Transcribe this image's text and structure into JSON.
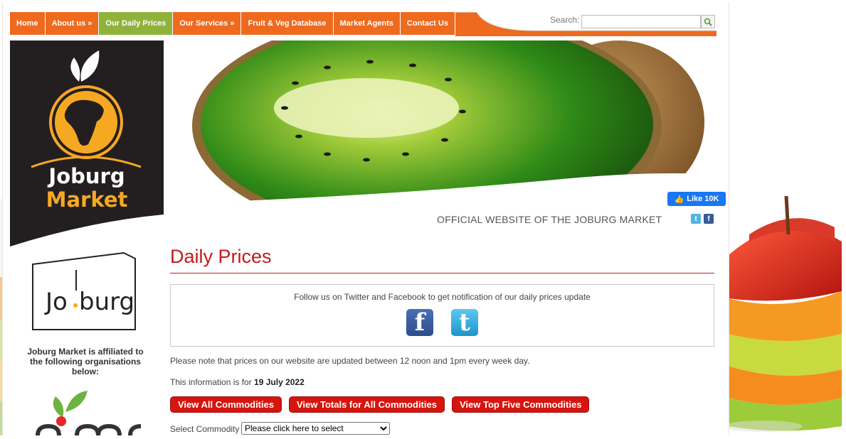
{
  "nav": {
    "items": [
      {
        "label": "Home"
      },
      {
        "label": "About us »"
      },
      {
        "label": "Our Daily Prices"
      },
      {
        "label": "Our Services »"
      },
      {
        "label": "Fruit & Veg Database"
      },
      {
        "label": "Market Agents"
      },
      {
        "label": "Contact Us"
      }
    ],
    "active_index": 2
  },
  "search": {
    "label": "Search:",
    "value": ""
  },
  "logo": {
    "line1": "Joburg",
    "line2": "Market"
  },
  "social": {
    "like_label": "Like 10K"
  },
  "tagline": "OFFICIAL WEBSITE OF THE JOBURG MARKET",
  "sidebar": {
    "joburg_logo_text": "Jo",
    "joburg_logo_text2": "burg",
    "affiliation_text": "Joburg Market is affiliated to the following organisations below:"
  },
  "main": {
    "title": "Daily Prices",
    "follow_text": "Follow us on Twitter and Facebook to get notification of our daily prices update",
    "note": "Please note that prices on our website are updated between 12 noon and 1pm every week day.",
    "info_prefix": "This information is for",
    "info_date": "19 July 2022",
    "buttons": [
      {
        "label": "View All Commodities"
      },
      {
        "label": "View Totals for All Commodities"
      },
      {
        "label": "View Top Five Commodities"
      }
    ],
    "select_label": "Select Commodity",
    "select_value": "Please click here to select"
  },
  "colors": {
    "nav_orange": "#ee6a1f",
    "nav_active": "#8fb23b",
    "title_red": "#c41a1a",
    "button_red": "#d6150f",
    "logo_orange": "#f7a823"
  }
}
